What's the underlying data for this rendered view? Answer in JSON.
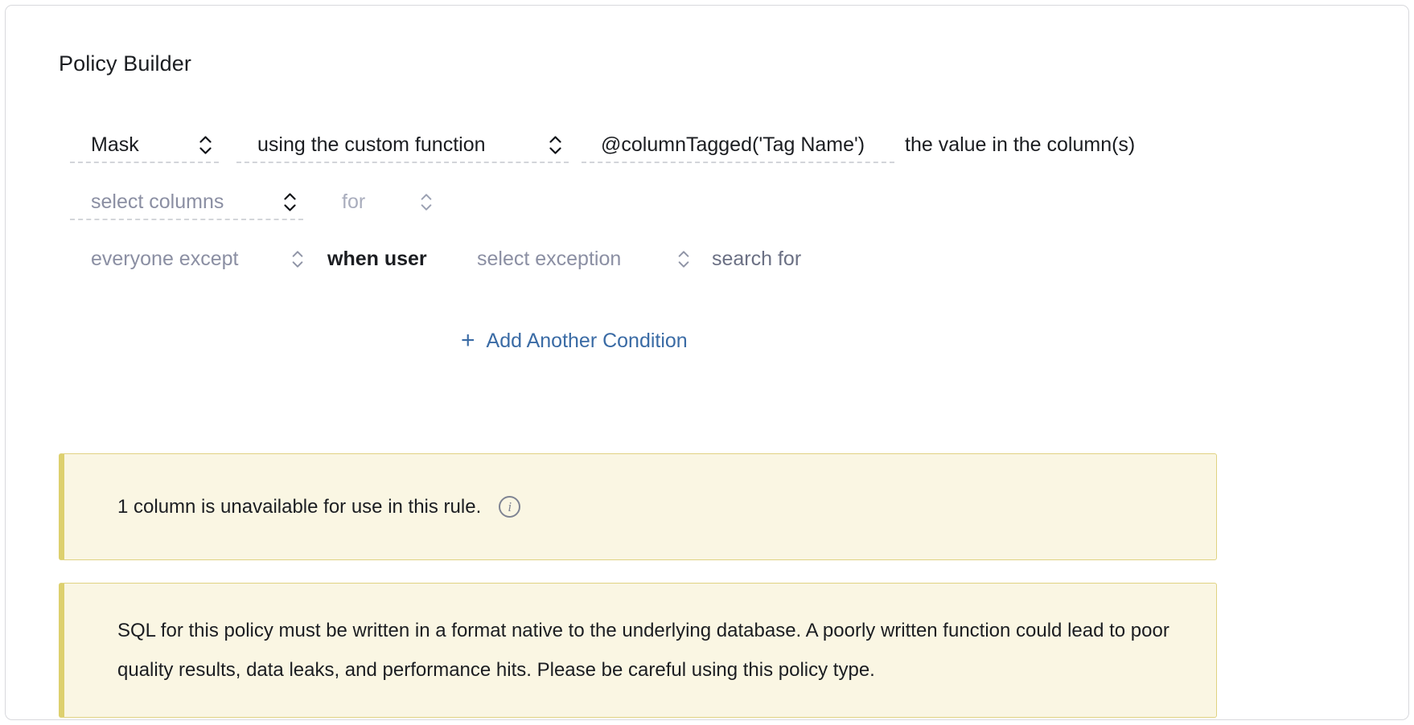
{
  "page": {
    "title": "Policy Builder"
  },
  "builder": {
    "row1": {
      "action": {
        "value": "Mask",
        "icon": "chevron-updown-icon"
      },
      "method": {
        "value": "using the custom function",
        "icon": "chevron-updown-icon"
      },
      "function": {
        "value": "@columnTagged('Tag Name')",
        "icon": "chevron-updown-icon"
      },
      "suffix": "the value in the column(s)"
    },
    "row2": {
      "columns": {
        "value": "select columns",
        "placeholder": "select columns",
        "icon": "chevron-updown-icon"
      },
      "for": {
        "value": "for",
        "placeholder": "for",
        "icon": "chevron-updown-icon"
      }
    },
    "row3": {
      "scope": {
        "value": "everyone except",
        "placeholder": "everyone except",
        "icon": "chevron-updown-icon"
      },
      "connector": "when user",
      "exception": {
        "value": "select exception",
        "placeholder": "select exception",
        "icon": "chevron-updown-icon"
      },
      "search_label": "search for"
    },
    "add_condition": {
      "label": "Add Another Condition",
      "icon": "plus-icon"
    }
  },
  "banners": [
    {
      "text": "1 column is unavailable for use in this rule.",
      "icon": "info-circle-icon",
      "accent_color": "#ddd06e",
      "background_color": "#faf6e3"
    },
    {
      "text": "SQL for this policy must be written in a format native to the underlying database. A poorly written function could lead to poor quality results, data leaks, and performance hits. Please be careful using this policy type.",
      "accent_color": "#ddd06e",
      "background_color": "#faf6e3"
    }
  ],
  "colors": {
    "link": "#3a6ba5",
    "text": "#1b1d21",
    "placeholder": "#8b8fa3",
    "card_border": "#d8d9dd"
  }
}
